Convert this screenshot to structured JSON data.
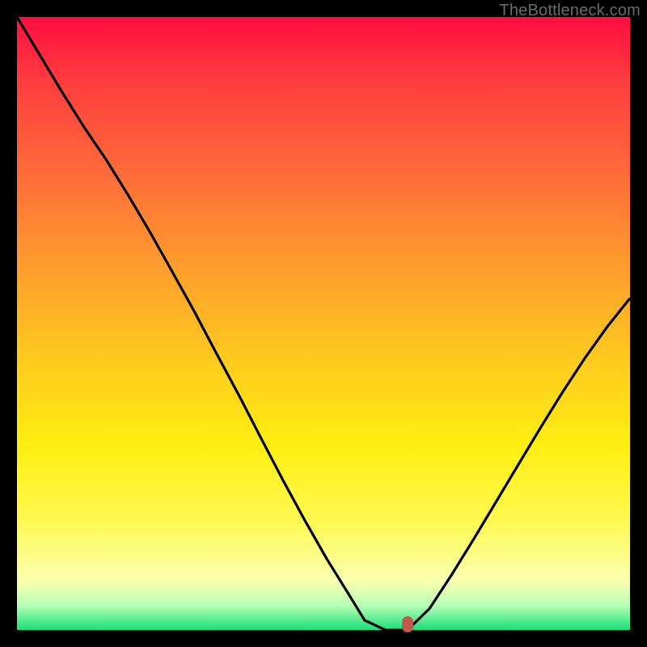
{
  "watermark": "TheBottleneck.com",
  "chart_data": {
    "type": "line",
    "title": "",
    "xlabel": "",
    "ylabel": "",
    "xlim": [
      0,
      100
    ],
    "ylim": [
      0,
      100
    ],
    "series": [
      {
        "name": "curve",
        "x": [
          0.0,
          3.6,
          7.2,
          10.9,
          14.5,
          18.1,
          21.7,
          25.3,
          28.9,
          32.5,
          36.2,
          39.8,
          43.4,
          47.0,
          50.6,
          54.2,
          56.7,
          60.1,
          63.7,
          67.3,
          70.9,
          74.6,
          78.2,
          81.8,
          85.4,
          89.0,
          92.6,
          96.3,
          99.9
        ],
        "values": [
          100.0,
          94.0,
          88.0,
          82.1,
          76.8,
          71.0,
          64.9,
          58.5,
          52.0,
          45.2,
          38.3,
          31.3,
          24.4,
          17.8,
          11.5,
          5.7,
          1.6,
          0.0,
          0.0,
          3.5,
          9.0,
          15.0,
          21.0,
          27.0,
          33.0,
          38.8,
          44.3,
          49.5,
          54.0
        ]
      }
    ],
    "marker": {
      "x": 63.7,
      "y": 0.9
    },
    "gradient_stops": [
      {
        "pos": 0,
        "color": "#ff0d3f"
      },
      {
        "pos": 10,
        "color": "#ff3b3f"
      },
      {
        "pos": 25,
        "color": "#ff6a3a"
      },
      {
        "pos": 40,
        "color": "#ff9a2e"
      },
      {
        "pos": 55,
        "color": "#ffc81f"
      },
      {
        "pos": 70,
        "color": "#ffee12"
      },
      {
        "pos": 82,
        "color": "#fff94f"
      },
      {
        "pos": 92,
        "color": "#faffb0"
      },
      {
        "pos": 96,
        "color": "#b6ffb6"
      },
      {
        "pos": 100,
        "color": "#18e07a"
      }
    ]
  }
}
